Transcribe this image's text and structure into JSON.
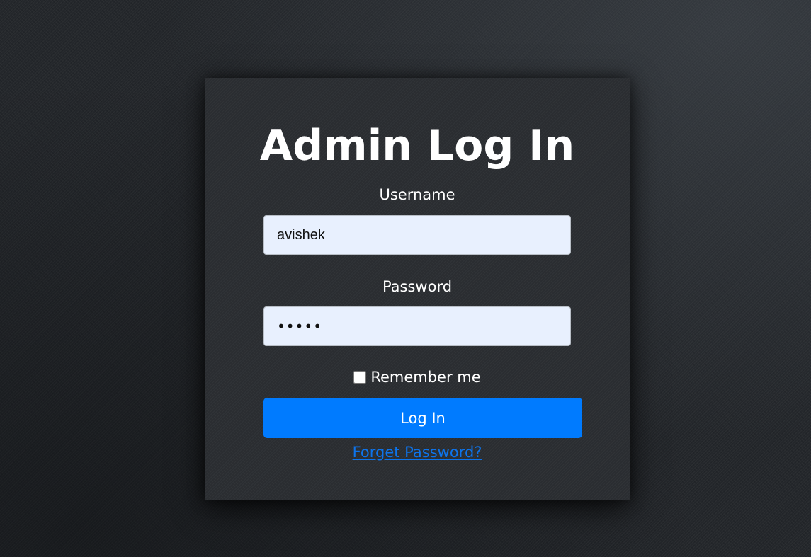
{
  "login": {
    "title": "Admin Log In",
    "username": {
      "label": "Username",
      "value": "avishek"
    },
    "password": {
      "label": "Password",
      "value": "•••••"
    },
    "remember": {
      "label": "Remember me",
      "checked": false
    },
    "submit_label": "Log In",
    "forgot_label": "Forget Password?"
  },
  "colors": {
    "background": "#24272b",
    "card": "#2a2d31",
    "input_fill": "#e8f0fe",
    "primary_button": "#007bff",
    "link": "#0d74ec",
    "text": "#ffffff"
  }
}
